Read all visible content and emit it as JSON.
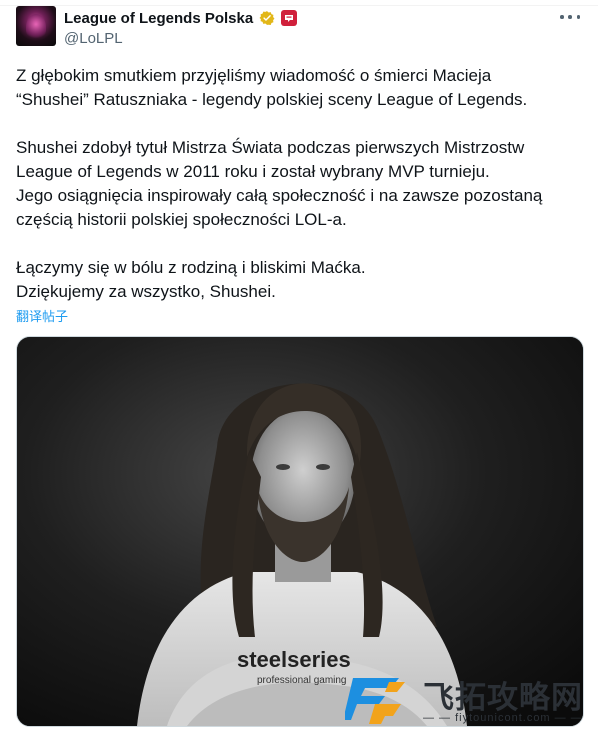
{
  "account": {
    "display_name": "League of Legends Polska",
    "handle": "@LoLPL"
  },
  "post": {
    "paragraphs": [
      "Z głębokim smutkiem przyjęliśmy wiadomość o śmierci Macieja\n“Shushei” Ratuszniaka - legendy polskiej sceny League of Legends.",
      "Shushei zdobył tytuł Mistrza Świata podczas pierwszych Mistrzostw\nLeague of Legends w 2011 roku i został wybrany MVP turnieju.\nJego osiągnięcia inspirowały całą społeczność i na zawsze pozostaną\nczęścią historii polskiej społeczności LOL-a.",
      "Łączymy się w bólu z rodziną i bliskimi Maćka.\nDziękujemy za wszystko, Shushei."
    ],
    "translate_label": "翻译帖子",
    "photo": {
      "shirt_text_main": "steelseries",
      "shirt_text_sub": "professional gaming"
    }
  },
  "watermark": {
    "title": "飞拓攻略网",
    "subtitle": "— — fiytounicont.com — —"
  },
  "colors": {
    "link": "#1d9bf0",
    "verified_gold": "#e2b719",
    "affiliate_red": "#d0203b",
    "muted_text": "#536471"
  }
}
